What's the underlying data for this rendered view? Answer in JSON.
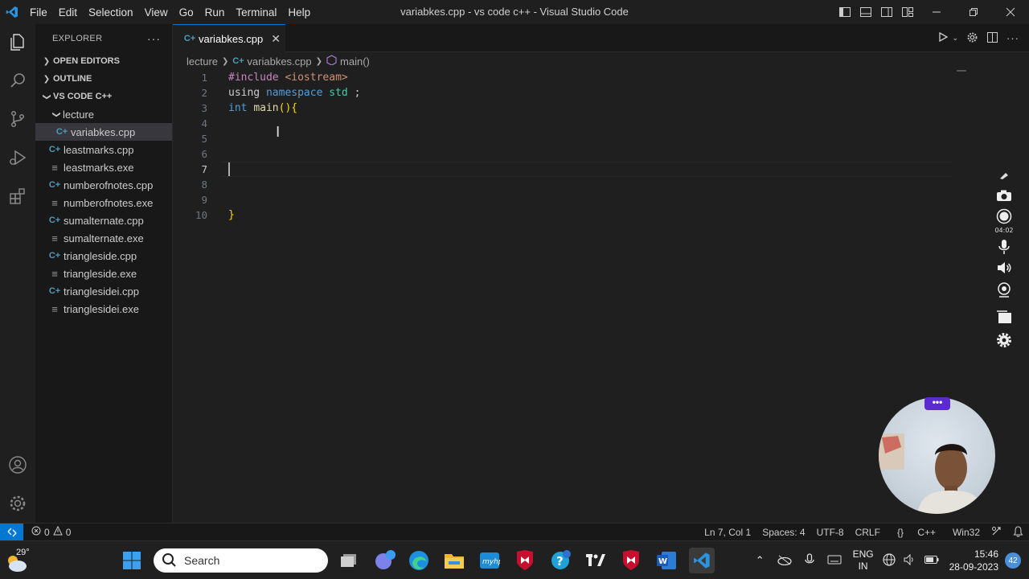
{
  "app": {
    "title": "variabkes.cpp - vs code c++ - Visual Studio Code",
    "menu": [
      "File",
      "Edit",
      "Selection",
      "View",
      "Go",
      "Run",
      "Terminal",
      "Help"
    ]
  },
  "sidebar": {
    "header": "EXPLORER",
    "sections": {
      "open_editors": "OPEN EDITORS",
      "outline": "OUTLINE",
      "workspace": "VS CODE C++"
    },
    "folder": "lecture",
    "files": [
      {
        "name": "variabkes.cpp",
        "type": "cpp"
      },
      {
        "name": "leastmarks.cpp",
        "type": "cpp"
      },
      {
        "name": "leastmarks.exe",
        "type": "exe"
      },
      {
        "name": "numberofnotes.cpp",
        "type": "cpp"
      },
      {
        "name": "numberofnotes.exe",
        "type": "exe"
      },
      {
        "name": "sumalternate.cpp",
        "type": "cpp"
      },
      {
        "name": "sumalternate.exe",
        "type": "exe"
      },
      {
        "name": "triangleside.cpp",
        "type": "cpp"
      },
      {
        "name": "triangleside.exe",
        "type": "exe"
      },
      {
        "name": "trianglesidei.cpp",
        "type": "cpp"
      },
      {
        "name": "trianglesidei.exe",
        "type": "exe"
      }
    ]
  },
  "tab": {
    "label": "variabkes.cpp"
  },
  "breadcrumb": {
    "folder": "lecture",
    "file": "variabkes.cpp",
    "symbol": "main()"
  },
  "editor": {
    "line_numbers": [
      "1",
      "2",
      "3",
      "4",
      "5",
      "6",
      "7",
      "8",
      "9",
      "10"
    ],
    "current_line": 7,
    "code": {
      "l1_directive": "#include",
      "l1_header": "<iostream>",
      "l2_using": "using",
      "l2_namespace": "namespace",
      "l2_std": "std",
      "l2_semi": ";",
      "l3_int": "int",
      "l3_main": "main",
      "l3_parens": "()",
      "l3_brace": "{",
      "l10_brace": "}"
    }
  },
  "recorder": {
    "time": "04:02"
  },
  "status": {
    "errors": "0",
    "warnings": "0",
    "position": "Ln 7, Col 1",
    "spaces": "Spaces: 4",
    "encoding": "UTF-8",
    "eol": "CRLF",
    "language": "C++",
    "platform": "Win32"
  },
  "taskbar": {
    "weather_temp": "29°",
    "search_placeholder": "Search",
    "lang_line1": "ENG",
    "lang_line2": "IN",
    "time": "15:46",
    "date": "28-09-2023",
    "notifications": "42"
  },
  "colors": {
    "accent": "#0078d4",
    "cam_badge": "#5b2bd0"
  }
}
